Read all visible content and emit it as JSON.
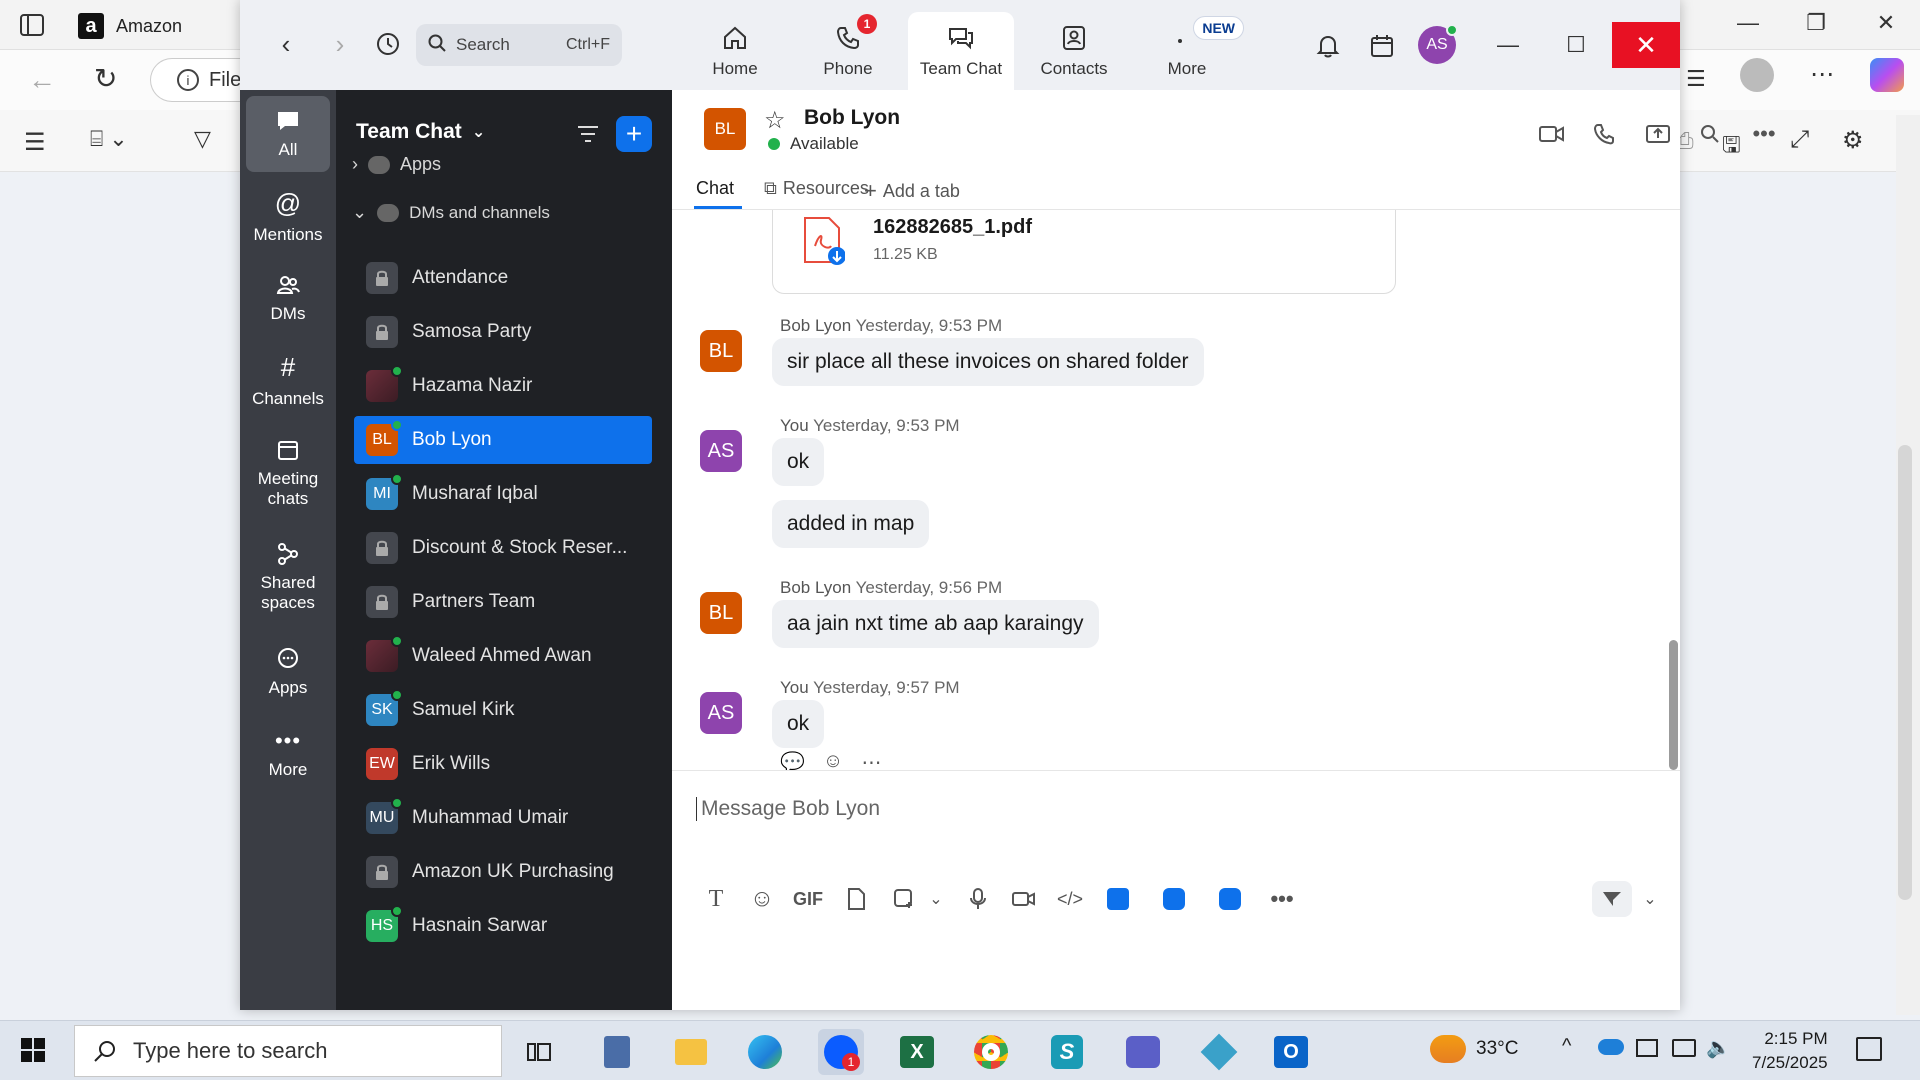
{
  "background_browser": {
    "tab_title": "Amazon",
    "address_partial": "File"
  },
  "zoom": {
    "search": {
      "placeholder": "Search",
      "shortcut": "Ctrl+F"
    },
    "nav_tabs": [
      {
        "label": "Home"
      },
      {
        "label": "Phone",
        "badge": "1"
      },
      {
        "label": "Team Chat"
      },
      {
        "label": "Contacts"
      },
      {
        "label": "More",
        "badge": "NEW"
      }
    ],
    "user_initials": "AS"
  },
  "rail": {
    "items": [
      {
        "label": "All"
      },
      {
        "label": "Mentions"
      },
      {
        "label": "DMs"
      },
      {
        "label": "Channels"
      },
      {
        "label": "Meeting chats"
      },
      {
        "label": "Shared spaces"
      },
      {
        "label": "Apps"
      },
      {
        "label": "More"
      }
    ]
  },
  "channel_list": {
    "title": "Team Chat",
    "sections": {
      "apps": "Apps",
      "dms": "DMs and channels"
    },
    "items": [
      {
        "label": "Attendance",
        "type": "lock"
      },
      {
        "label": "Samosa Party",
        "type": "lock"
      },
      {
        "label": "Hazama Nazir",
        "type": "photo"
      },
      {
        "label": "Bob Lyon",
        "initials": "BL",
        "color": "#d35400"
      },
      {
        "label": "Musharaf Iqbal",
        "initials": "MI",
        "color": "#2e86c1"
      },
      {
        "label": "Discount & Stock Reser...",
        "type": "lock"
      },
      {
        "label": "Partners Team",
        "type": "lock"
      },
      {
        "label": "Waleed Ahmed Awan",
        "type": "photo"
      },
      {
        "label": "Samuel Kirk",
        "initials": "SK",
        "color": "#2e86c1"
      },
      {
        "label": "Erik Wills",
        "initials": "EW",
        "color": "#c0392b"
      },
      {
        "label": "Muhammad Umair",
        "initials": "MU",
        "color": "#34495e"
      },
      {
        "label": "Amazon UK Purchasing",
        "type": "lock"
      },
      {
        "label": "Hasnain Sarwar",
        "initials": "HS",
        "color": "#27ae60"
      }
    ]
  },
  "chat": {
    "contact_name": "Bob Lyon",
    "contact_initials": "BL",
    "status": "Available",
    "tabs": {
      "chat": "Chat",
      "resources": "Resources",
      "add": "Add a tab"
    },
    "file": {
      "name": "162882685_1.pdf",
      "size": "11.25 KB"
    },
    "messages": [
      {
        "sender": "Bob Lyon",
        "initials": "BL",
        "time": "Yesterday, 9:53 PM",
        "bubbles": [
          "sir place all these invoices on shared folder"
        ]
      },
      {
        "sender": "You",
        "initials": "AS",
        "time": "Yesterday, 9:53 PM",
        "bubbles": [
          "ok",
          "added in map"
        ]
      },
      {
        "sender": "Bob Lyon",
        "initials": "BL",
        "time": "Yesterday, 9:56 PM",
        "bubbles": [
          "aa jain nxt time ab aap karaingy"
        ]
      },
      {
        "sender": "You",
        "initials": "AS",
        "time": "Yesterday, 9:57 PM",
        "bubbles": [
          "ok"
        ]
      }
    ],
    "composer_placeholder": "Message Bob Lyon",
    "gif_label": "GIF"
  },
  "taskbar": {
    "search_placeholder": "Type here to search",
    "zoom_badge": "1",
    "temperature": "33°C",
    "time": "2:15 PM",
    "date": "7/25/2025"
  }
}
